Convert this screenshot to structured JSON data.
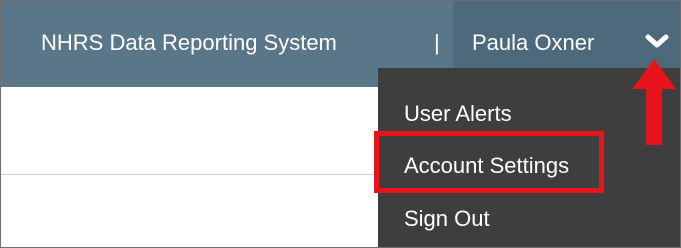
{
  "header": {
    "app_title": "NHRS Data Reporting System",
    "separator": "|",
    "user_name": "Paula Oxner",
    "dropdown_icon": "chevron-down-icon"
  },
  "user_menu": {
    "items": [
      {
        "label": "User Alerts"
      },
      {
        "label": "Account Settings"
      },
      {
        "label": "Sign Out"
      }
    ],
    "highlighted_item": "Account Settings"
  },
  "annotation": {
    "arrow_icon": "red-up-arrow-icon",
    "highlight_color": "#e8141b"
  },
  "colors": {
    "topbar": "#597788",
    "user_section": "#4c6a7b",
    "dropdown": "#3e3e3e",
    "text": "#ffffff"
  }
}
